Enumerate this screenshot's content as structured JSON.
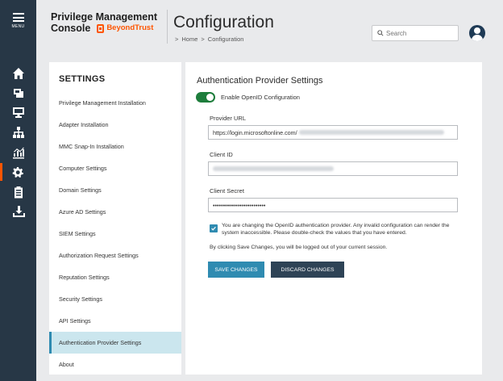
{
  "rail": {
    "menu_label": "MENU",
    "items": [
      "home-icon",
      "badge-icon",
      "computer-icon",
      "hierarchy-icon",
      "analytics-icon",
      "settings-icon",
      "clipboard-icon",
      "download-icon"
    ],
    "active_index": 5,
    "active_color": "#ff5500"
  },
  "header": {
    "brand_line1": "Privilege Management",
    "brand_line2": "Console",
    "brand_logo_text": "BeyondTrust",
    "title": "Configuration",
    "breadcrumb": [
      "Home",
      "Configuration"
    ],
    "breadcrumb_sep": ">",
    "search_placeholder": "Search"
  },
  "settings": {
    "heading": "SETTINGS",
    "items": [
      "Privilege Management Installation",
      "Adapter Installation",
      "MMC Snap-In Installation",
      "Computer Settings",
      "Domain Settings",
      "Azure AD Settings",
      "SIEM Settings",
      "Authorization Request Settings",
      "Reputation Settings",
      "Security Settings",
      "API Settings",
      "Authentication Provider Settings",
      "About"
    ],
    "active_index": 11
  },
  "main": {
    "heading": "Authentication Provider Settings",
    "toggle_label": "Enable OpenID Configuration",
    "toggle_on": true,
    "provider_url_label": "Provider URL",
    "provider_url_value": "https://login.microsoftonline.com/",
    "client_id_label": "Client ID",
    "client_secret_label": "Client Secret",
    "client_secret_value": "••••••••••••••••••••••••••",
    "warning_checked": true,
    "warning_text": "You are changing the OpenID authentication provider. Any invalid configuration can render the system inaccessible. Please double-check the values that you have entered.",
    "logout_note": "By clicking Save Changes, you will be logged out of your current session.",
    "save_label": "SAVE CHANGES",
    "discard_label": "DISCARD CHANGES"
  }
}
